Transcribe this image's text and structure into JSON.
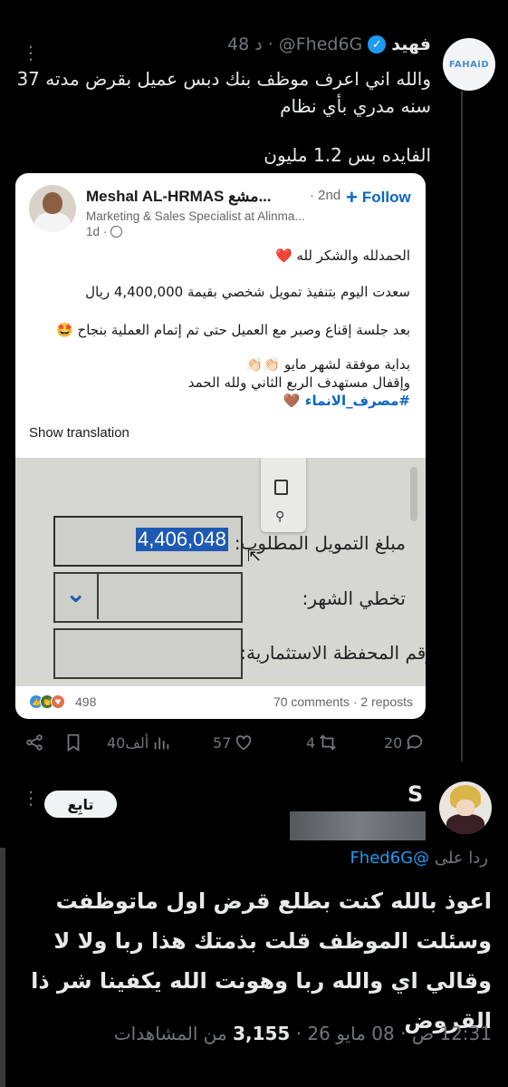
{
  "tweet": {
    "author_name": "فهيد",
    "handle": "@Fhed6G",
    "time": "48 د",
    "avatar_text": "FAHAiD",
    "text_line1": "والله اني اعرف موظف بنك دبس عميل بقرض مدته 37 سنه مدري بأي نظام",
    "text_line2": "الفايده بس 1.2 مليون",
    "actions": {
      "replies": "20",
      "reposts": "4",
      "likes": "57",
      "views": "40ألف"
    }
  },
  "linkedin": {
    "name": "Meshal AL-HRMAS مشع...",
    "time": "· 2nd",
    "follow_label": "Follow",
    "title": "Marketing & Sales Specialist at Alinma...",
    "age": "1d ·",
    "lines": [
      "الحمدلله والشكر لله ❤️",
      "سعدت اليوم بتنفيذ تمويل شخصي بقيمة 4,400,000 ريال",
      "بعد جلسة إقناع وصبر مع العميل حتى تم إتمام العملية بنجاح 🤩",
      "بداية موفقة لشهر مايو 👏🏻👏🏻",
      "وإقفال مستهدف الربع الثاني ولله الحمد",
      "#مصرف_الانماء 🤎"
    ],
    "show_translation": "Show translation",
    "reaction_count": "498",
    "stats": "70 comments · 2 reposts",
    "photo": {
      "amount": "4,406,048",
      "label_amount": "مبلغ التمويل المطلوب:",
      "label_month": "تخطي الشهر:",
      "label_portfolio": "رقم المحفظة الاستثمارية:"
    }
  },
  "reply": {
    "name": "S",
    "follow_label": "تابِع",
    "reply_to_prefix": "ردا على",
    "reply_to_handle": "@Fhed6G",
    "text": "اعوذ بالله كنت بطلع قرض اول ماتوظفت  وسئلت الموظف قلت بذمتك هذا ربا ولا لا وقالي اي والله ربا وهونت الله يكفينا شر ذا القروض",
    "time": "12:31 ص",
    "date": "08 مايو 26",
    "views": "3,155",
    "views_label": "من المشاهدات"
  },
  "colors": {
    "background": "#000000",
    "text": "#e7e9ea",
    "muted": "#71767b",
    "twitter_blue": "#1d9bf0",
    "linkedin_blue": "#0a66c2"
  }
}
